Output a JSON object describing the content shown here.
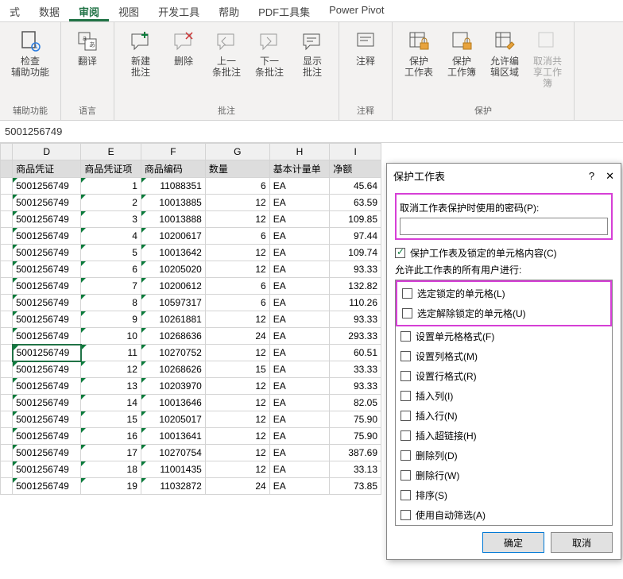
{
  "tabs": {
    "t0": "式",
    "t1": "数据",
    "t2": "审阅",
    "t3": "视图",
    "t4": "开发工具",
    "t5": "帮助",
    "t6": "PDF工具集",
    "t7": "Power Pivot"
  },
  "ribbon": {
    "g0": {
      "b0": "检查\n辅助功能",
      "label": "辅助功能"
    },
    "g1": {
      "b0": "翻译",
      "label": "语言"
    },
    "g2": {
      "b0": "新建\n批注",
      "b1": "删除",
      "b2": "上一\n条批注",
      "b3": "下一\n条批注",
      "b4": "显示\n批注",
      "label": "批注"
    },
    "g3": {
      "b0": "注释",
      "label": "注释"
    },
    "g4": {
      "b0": "保护\n工作表",
      "b1": "保护\n工作簿",
      "b2": "允许编\n辑区域",
      "b3": "取消共\n享工作簿",
      "label": "保护"
    }
  },
  "formula": "5001256749",
  "cols": {
    "D": "D",
    "E": "E",
    "F": "F",
    "G": "G",
    "H": "H",
    "I": "I"
  },
  "headers": {
    "h0": "商品凭证",
    "h1": "商品凭证项",
    "h2": "商品编码",
    "h3": "数量",
    "h4": "基本计量单",
    "h5": "净额"
  },
  "rows": [
    {
      "c0": "5001256749",
      "c1": "1",
      "c2": "11088351",
      "c3": "6",
      "c4": "EA",
      "c5": "45.64"
    },
    {
      "c0": "5001256749",
      "c1": "2",
      "c2": "10013885",
      "c3": "12",
      "c4": "EA",
      "c5": "63.59"
    },
    {
      "c0": "5001256749",
      "c1": "3",
      "c2": "10013888",
      "c3": "12",
      "c4": "EA",
      "c5": "109.85"
    },
    {
      "c0": "5001256749",
      "c1": "4",
      "c2": "10200617",
      "c3": "6",
      "c4": "EA",
      "c5": "97.44"
    },
    {
      "c0": "5001256749",
      "c1": "5",
      "c2": "10013642",
      "c3": "12",
      "c4": "EA",
      "c5": "109.74"
    },
    {
      "c0": "5001256749",
      "c1": "6",
      "c2": "10205020",
      "c3": "12",
      "c4": "EA",
      "c5": "93.33"
    },
    {
      "c0": "5001256749",
      "c1": "7",
      "c2": "10200612",
      "c3": "6",
      "c4": "EA",
      "c5": "132.82"
    },
    {
      "c0": "5001256749",
      "c1": "8",
      "c2": "10597317",
      "c3": "6",
      "c4": "EA",
      "c5": "110.26"
    },
    {
      "c0": "5001256749",
      "c1": "9",
      "c2": "10261881",
      "c3": "12",
      "c4": "EA",
      "c5": "93.33"
    },
    {
      "c0": "5001256749",
      "c1": "10",
      "c2": "10268636",
      "c3": "24",
      "c4": "EA",
      "c5": "293.33"
    },
    {
      "c0": "5001256749",
      "c1": "11",
      "c2": "10270752",
      "c3": "12",
      "c4": "EA",
      "c5": "60.51"
    },
    {
      "c0": "5001256749",
      "c1": "12",
      "c2": "10268626",
      "c3": "15",
      "c4": "EA",
      "c5": "33.33"
    },
    {
      "c0": "5001256749",
      "c1": "13",
      "c2": "10203970",
      "c3": "12",
      "c4": "EA",
      "c5": "93.33"
    },
    {
      "c0": "5001256749",
      "c1": "14",
      "c2": "10013646",
      "c3": "12",
      "c4": "EA",
      "c5": "82.05"
    },
    {
      "c0": "5001256749",
      "c1": "15",
      "c2": "10205017",
      "c3": "12",
      "c4": "EA",
      "c5": "75.90"
    },
    {
      "c0": "5001256749",
      "c1": "16",
      "c2": "10013641",
      "c3": "12",
      "c4": "EA",
      "c5": "75.90"
    },
    {
      "c0": "5001256749",
      "c1": "17",
      "c2": "10270754",
      "c3": "12",
      "c4": "EA",
      "c5": "387.69"
    },
    {
      "c0": "5001256749",
      "c1": "18",
      "c2": "11001435",
      "c3": "12",
      "c4": "EA",
      "c5": "33.13"
    },
    {
      "c0": "5001256749",
      "c1": "19",
      "c2": "11032872",
      "c3": "24",
      "c4": "EA",
      "c5": "73.85"
    }
  ],
  "dialog": {
    "title": "保护工作表",
    "help": "?",
    "close": "✕",
    "password_label": "取消工作表保护时使用的密码(P):",
    "password_value": "",
    "protect_check": "保护工作表及锁定的单元格内容(C)",
    "allow_label": "允许此工作表的所有用户进行:",
    "perms": [
      "选定锁定的单元格(L)",
      "选定解除锁定的单元格(U)",
      "设置单元格格式(F)",
      "设置列格式(M)",
      "设置行格式(R)",
      "插入列(I)",
      "插入行(N)",
      "插入超链接(H)",
      "删除列(D)",
      "删除行(W)",
      "排序(S)",
      "使用自动筛选(A)"
    ],
    "ok": "确定",
    "cancel": "取消"
  }
}
